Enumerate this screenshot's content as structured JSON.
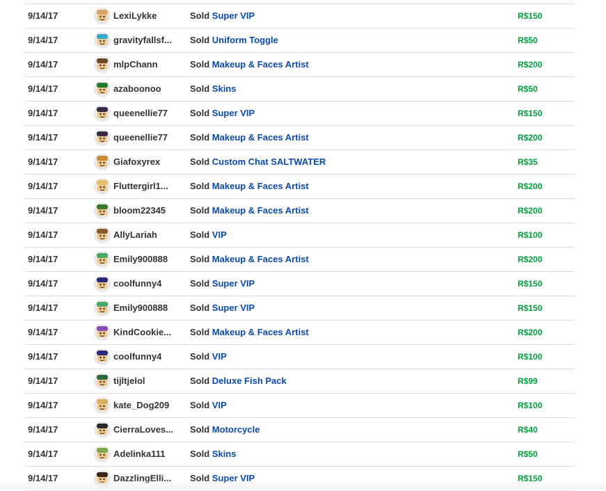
{
  "sold_label": "Sold",
  "currency_symbol": "R$",
  "colors": {
    "item_link": "#0a4aa8",
    "price": "#00a03c",
    "divider": "#dcdcdc"
  },
  "rows": [
    {
      "date": "9/14/17",
      "user": "LexiLykke",
      "item": "Super VIP",
      "price": "150",
      "avatar": "#d9a566"
    },
    {
      "date": "9/14/17",
      "user": "gravityfallsf...",
      "item": "Uniform Toggle",
      "price": "50",
      "avatar": "#39a9c9"
    },
    {
      "date": "9/14/17",
      "user": "mlpChann",
      "item": "Makeup & Faces Artist",
      "price": "200",
      "avatar": "#6b4a2a"
    },
    {
      "date": "9/14/17",
      "user": "azaboonoo",
      "item": "Skins",
      "price": "50",
      "avatar": "#1f7a2c"
    },
    {
      "date": "9/14/17",
      "user": "queenellie77",
      "item": "Super VIP",
      "price": "150",
      "avatar": "#3a2a4a"
    },
    {
      "date": "9/14/17",
      "user": "queenellie77",
      "item": "Makeup & Faces Artist",
      "price": "200",
      "avatar": "#3a2a4a"
    },
    {
      "date": "9/14/17",
      "user": "Giafoxyrex",
      "item": "Custom Chat SALTWATER",
      "price": "35",
      "avatar": "#c98a3a"
    },
    {
      "date": "9/14/17",
      "user": "Fluttergirl1...",
      "item": "Makeup & Faces Artist",
      "price": "200",
      "avatar": "#e3c06a"
    },
    {
      "date": "9/14/17",
      "user": "bloom22345",
      "item": "Makeup & Faces Artist",
      "price": "200",
      "avatar": "#3a7a2a"
    },
    {
      "date": "9/14/17",
      "user": "AllyLariah",
      "item": "VIP",
      "price": "100",
      "avatar": "#8a5a2a"
    },
    {
      "date": "9/14/17",
      "user": "Emily900888",
      "item": "Makeup & Faces Artist",
      "price": "200",
      "avatar": "#4aa868"
    },
    {
      "date": "9/14/17",
      "user": "coolfunny4",
      "item": "Super VIP",
      "price": "150",
      "avatar": "#2a2a7a"
    },
    {
      "date": "9/14/17",
      "user": "Emily900888",
      "item": "Super VIP",
      "price": "150",
      "avatar": "#4aa868"
    },
    {
      "date": "9/14/17",
      "user": "KindCookie...",
      "item": "Makeup & Faces Artist",
      "price": "200",
      "avatar": "#8a4ab8"
    },
    {
      "date": "9/14/17",
      "user": "coolfunny4",
      "item": "VIP",
      "price": "100",
      "avatar": "#2a2a7a"
    },
    {
      "date": "9/14/17",
      "user": "tijltjelol",
      "item": "Deluxe Fish Pack",
      "price": "99",
      "avatar": "#2a6a3a"
    },
    {
      "date": "9/14/17",
      "user": "kate_Dog209",
      "item": "VIP",
      "price": "100",
      "avatar": "#d8b060"
    },
    {
      "date": "9/14/17",
      "user": "CierraLoves...",
      "item": "Motorcycle",
      "price": "40",
      "avatar": "#2a2a2a"
    },
    {
      "date": "9/14/17",
      "user": "Adelinka111",
      "item": "Skins",
      "price": "50",
      "avatar": "#7aa84a"
    },
    {
      "date": "9/14/17",
      "user": "DazzlingElli...",
      "item": "Super VIP",
      "price": "150",
      "avatar": "#3a2a1a"
    }
  ]
}
